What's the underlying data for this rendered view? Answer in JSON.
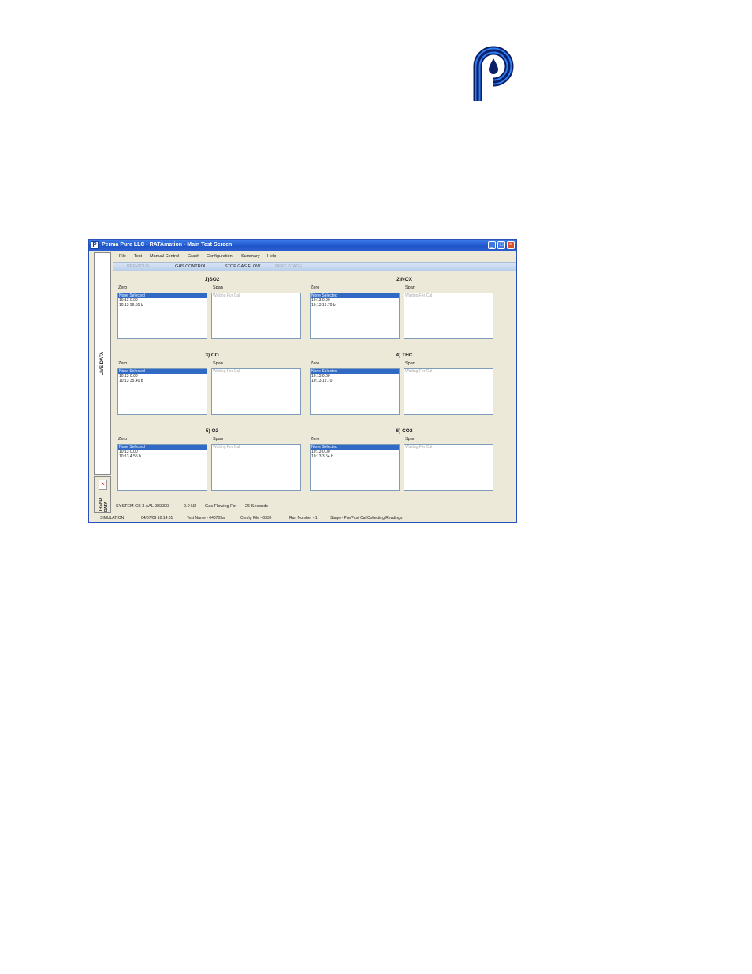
{
  "window": {
    "title": "Perma Pure LLC - RATAmation - Main Test Screen"
  },
  "side_tabs": {
    "live": "LIVE DATA",
    "trend_line1": "TREND",
    "trend_line2": "DATA"
  },
  "menu": [
    "File",
    "Test",
    "Manual Control",
    "Graph",
    "Configuration",
    "Summary",
    "Help"
  ],
  "toolbar": {
    "prev": "PREVIOUS",
    "gas_control": "GAS CONTROL",
    "stop_gas_flow": "STOP GAS FLOW",
    "next": "NEXT STAGE"
  },
  "labels": {
    "zero": "Zero",
    "span": "Span"
  },
  "panels": [
    {
      "title": "1)SO2",
      "zero": [
        "None Selected",
        "10:13  0.00",
        "10:13  96.55 b"
      ],
      "span": [
        "Waiting For Cal"
      ]
    },
    {
      "title": "2)NOX",
      "zero": [
        "None Selected",
        "10:13  0.00",
        "10:13  19.70 b"
      ],
      "span": [
        "Waiting For Cal"
      ]
    },
    {
      "title": "3) CO",
      "zero": [
        "None Selected",
        "10:13  0.00",
        "10:13  35.40 b"
      ],
      "span": [
        "Waiting For Cal"
      ]
    },
    {
      "title": "4) THC",
      "zero": [
        "None Selected",
        "10:13  0.00",
        "10:13  19.70"
      ],
      "span": [
        "Waiting For Cal"
      ]
    },
    {
      "title": "5) O2",
      "zero": [
        "None Selected",
        "10:13  0.00",
        "10:13  4.55 b"
      ],
      "span": [
        "Waiting For Cal"
      ]
    },
    {
      "title": "6) CO2",
      "zero": [
        "None Selected",
        "10:13  0.00",
        "10:13  3.54 b"
      ],
      "span": [
        "Waiting For Cal"
      ]
    }
  ],
  "status1": {
    "system": "SYSTEM CS 3 AAL-333333",
    "gas": "0.0  N2",
    "flow_label": "Gas Flowing For",
    "flow_time": "26 Seconds"
  },
  "status2": {
    "mode": "SIMULATION",
    "datetime": "04/07/09 10:14:01",
    "test_name": "Test Name - 040709a",
    "config": "Config File - 0330",
    "run": "Run Number -  1",
    "stage": "Stage - Pre/Post Cal Collecting Readings"
  },
  "colors": {
    "accent": "#316ac5",
    "titlebar": "#1f55c9",
    "logo": "#1c5bd6"
  }
}
